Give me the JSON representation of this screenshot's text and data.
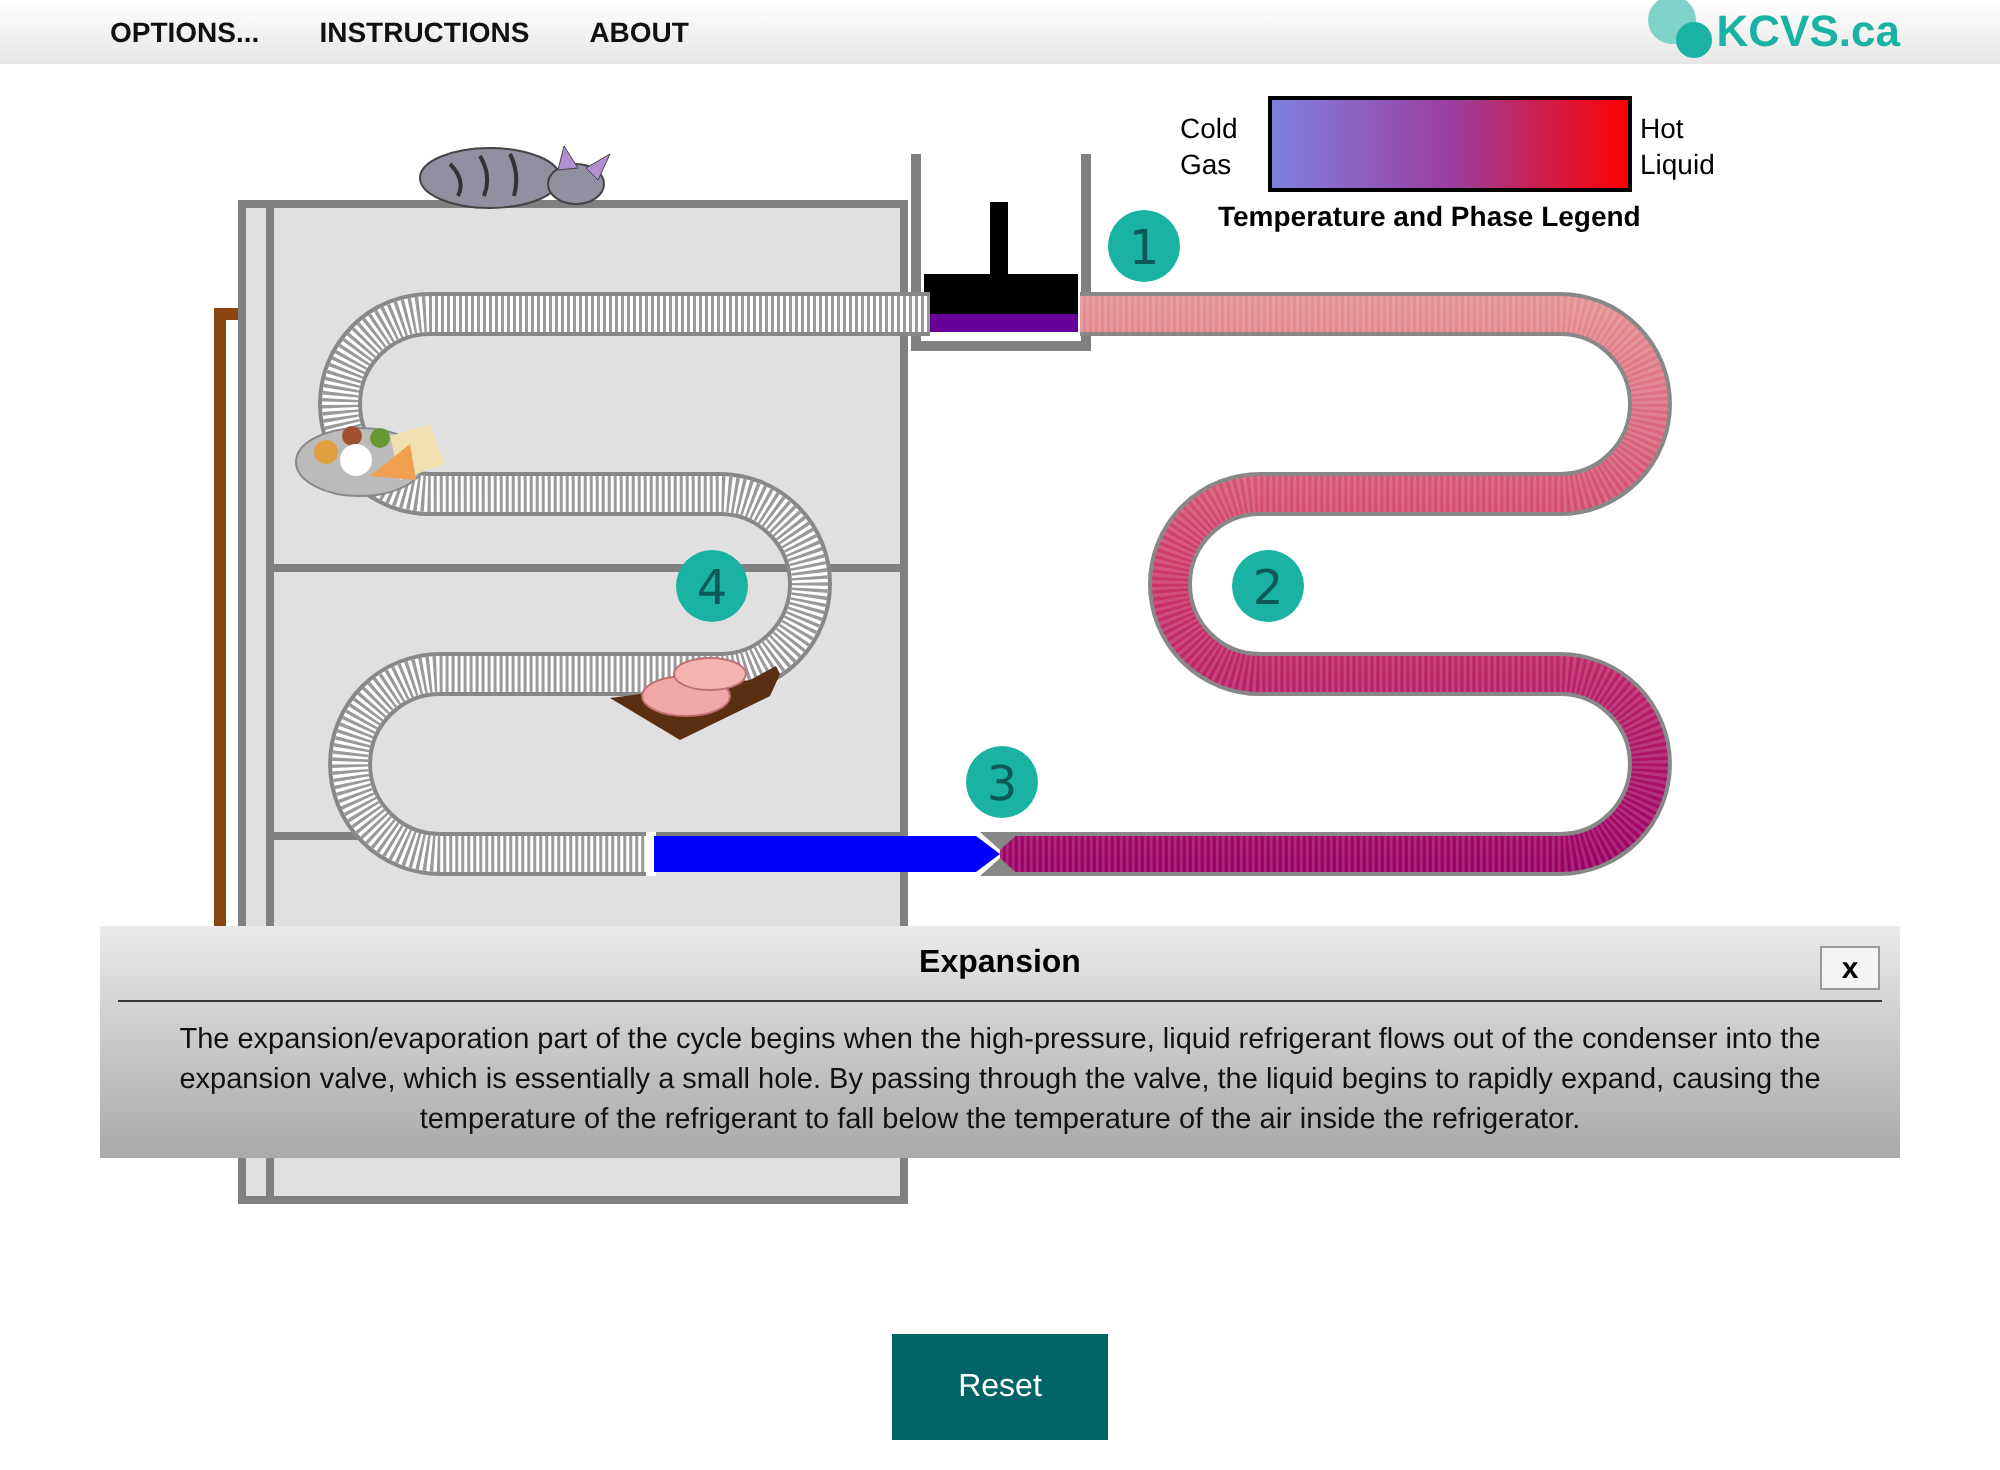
{
  "menu": [
    {
      "label": "OPTIONS..."
    },
    {
      "label": "INSTRUCTIONS"
    },
    {
      "label": "ABOUT"
    }
  ],
  "logo": {
    "text": "KCVS.ca"
  },
  "legend": {
    "left": [
      "Cold",
      "Gas"
    ],
    "right": [
      "Hot",
      "Liquid"
    ],
    "title": "Temperature and Phase Legend"
  },
  "steps": [
    "1",
    "2",
    "3",
    "4"
  ],
  "popup": {
    "title": "Expansion",
    "close": "x",
    "text": "The expansion/evaporation part of the cycle begins when the high-pressure, liquid refrigerant flows out of the condenser into the expansion valve, which is essentially a small hole. By passing through the valve, the liquid begins to rapidly expand, causing the temperature of the refrigerant to fall below the temperature of the air inside the refrigerator."
  },
  "reset": "Reset"
}
